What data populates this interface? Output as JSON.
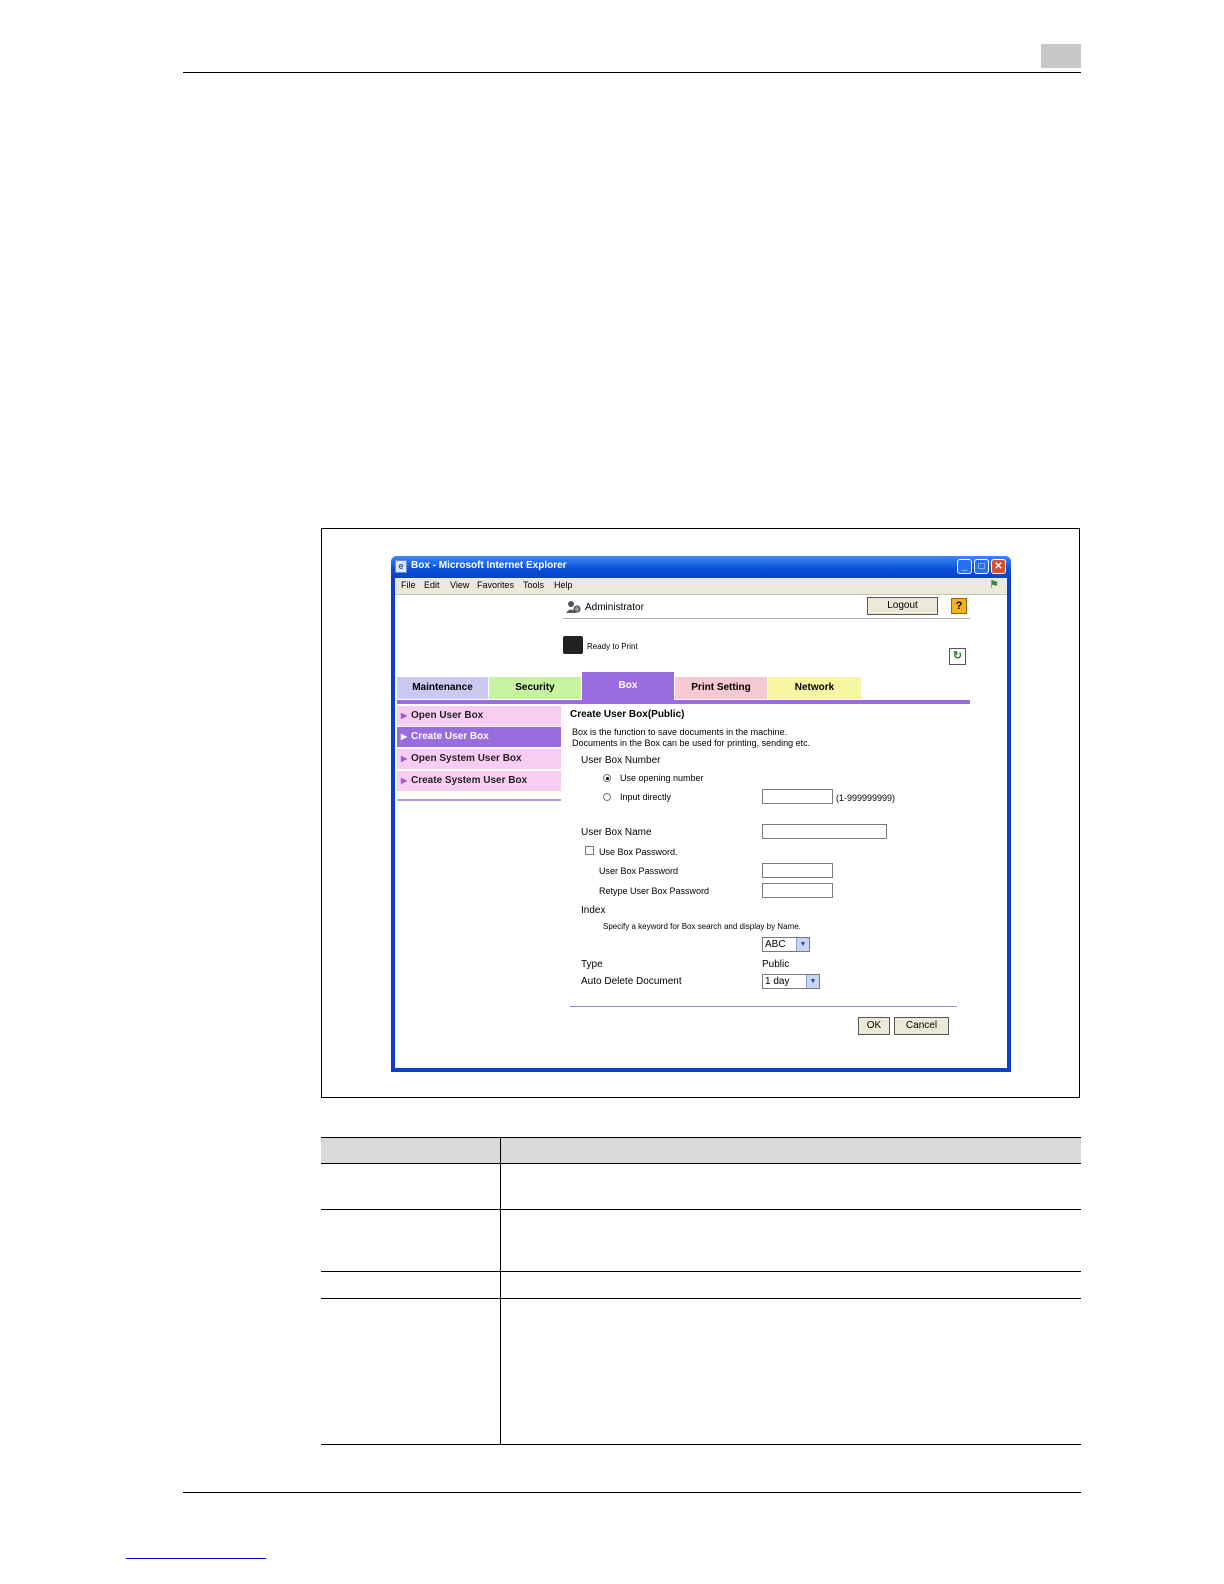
{
  "window": {
    "title": "Box - Microsoft Internet Explorer",
    "menu": [
      "File",
      "Edit",
      "View",
      "Favorites",
      "Tools",
      "Help"
    ]
  },
  "page_header": {
    "user": "Administrator",
    "logout_label": "Logout",
    "help_label": "?",
    "status": "Ready to Print"
  },
  "tabs": [
    {
      "label": "Maintenance",
      "color": "#c9c9f2"
    },
    {
      "label": "Security",
      "color": "#c7f2a0"
    },
    {
      "label": "Box",
      "color": "#9b6be2"
    },
    {
      "label": "Print Setting",
      "color": "#f7c9d2"
    },
    {
      "label": "Network",
      "color": "#f7f7a2"
    }
  ],
  "sidebar": {
    "items": [
      {
        "label": "Open User Box",
        "selected": false
      },
      {
        "label": "Create User Box",
        "selected": true
      },
      {
        "label": "Open System User Box",
        "selected": false
      },
      {
        "label": "Create System User Box",
        "selected": false
      }
    ]
  },
  "form": {
    "title": "Create User Box(Public)",
    "desc_line1": "Box is the function to save documents in the machine.",
    "desc_line2": "Documents in the Box can be used for printing, sending etc.",
    "box_number_label": "User Box Number",
    "opt_use_opening": "Use opening number",
    "opt_input_directly": "Input directly",
    "range_hint": "(1-999999999)",
    "box_name_label": "User Box Name",
    "use_password_label": "Use Box Password.",
    "password_label": "User Box Password",
    "retype_password_label": "Retype User Box Password",
    "index_label": "Index",
    "index_hint": "Specify a keyword for Box search and display by Name.",
    "index_value": "ABC",
    "type_label": "Type",
    "type_value": "Public",
    "auto_delete_label": "Auto Delete Document",
    "auto_delete_value": "1 day",
    "ok_label": "OK",
    "cancel_label": "Cancel"
  }
}
